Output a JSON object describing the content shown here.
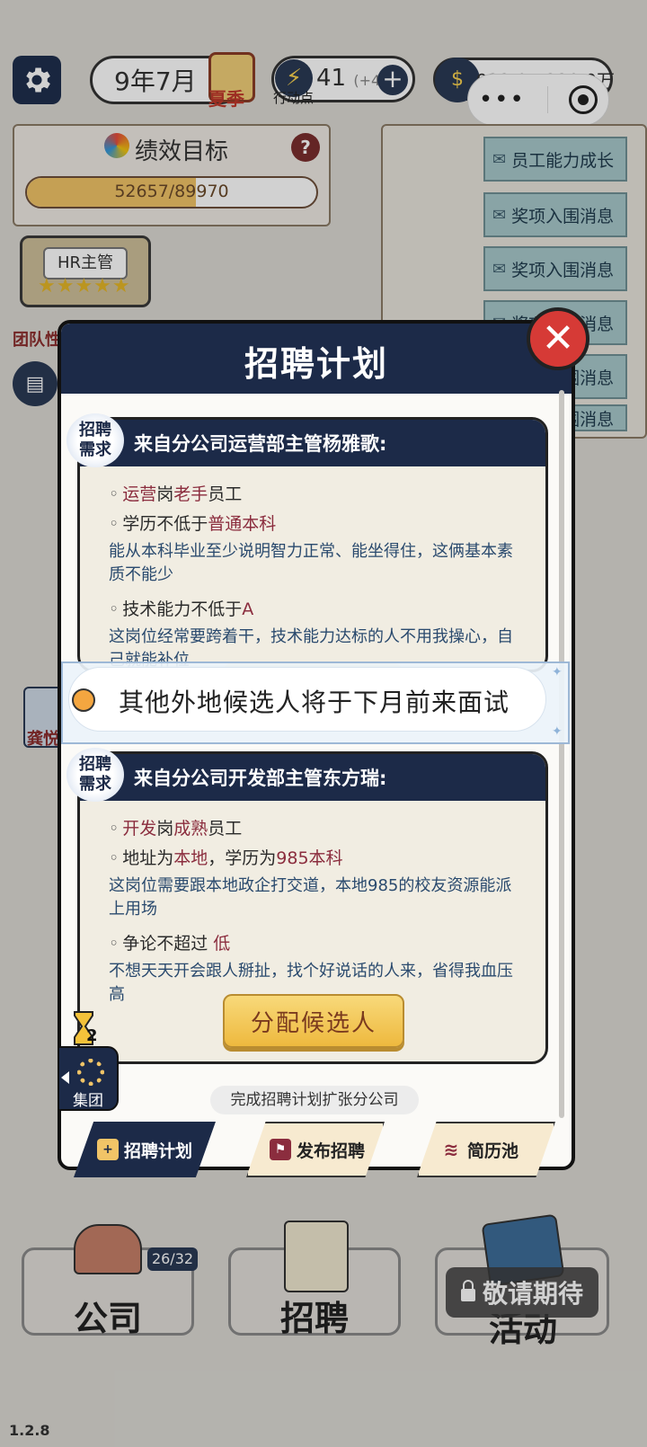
{
  "hud": {
    "date": "9年7月",
    "season": "夏季",
    "energy_value": "41",
    "energy_bonus": "(+4)",
    "energy_label": "行动点",
    "energy_plus": "+",
    "money": "933.9/1330.0万",
    "money_icon": "$"
  },
  "performance": {
    "title": "绩效目标",
    "help": "?",
    "progress_text": "52657/89970",
    "progress_fraction": 0.585
  },
  "hr": {
    "label": "HR主管",
    "stars": "★★★★★"
  },
  "team_label": "团队性",
  "messages": [
    "员工能力成长",
    "奖项入围消息",
    "奖项入围消息",
    "奖项入围消息",
    "奖项入围消息",
    "奖项入围消息"
  ],
  "side_employee_name": "龚悦",
  "modal": {
    "title": "招聘计划",
    "close_symbol": "✕",
    "badge_text_line1": "招聘",
    "badge_text_line2": "需求",
    "card1": {
      "header": "来自分公司运营部主管杨雅歌:",
      "item1_pre": "运营",
      "item1_mid": "岗",
      "item1_hl": "老手",
      "item1_post": "员工",
      "item2_pre": "学历不低于",
      "item2_hl": "普通本科",
      "item2_desc": "能从本科毕业至少说明智力正常、能坐得住，这俩基本素质不能少",
      "item3_pre": "技术能力不低于",
      "item3_hl": "A",
      "item3_desc": "这岗位经常要跨着干，技术能力达标的人不用我操心，自己就能补位"
    },
    "card2": {
      "header": "来自分公司开发部主管东方瑞:",
      "item1_pre": "开发",
      "item1_mid": "岗",
      "item1_hl": "成熟",
      "item1_post": "员工",
      "item2_a": "地址为",
      "item2_hl1": "本地",
      "item2_b": "，学历为",
      "item2_hl2": "985本科",
      "item2_desc": "这岗位需要跟本地政企打交道，本地985的校友资源能派上用场",
      "item3_pre": "争论不超过 ",
      "item3_hl": "低",
      "item3_desc": "不想天天开会跟人掰扯，找个好说话的人来，省得我血压高"
    },
    "assign_button": "分配候选人",
    "toast": "其他外地候选人将于下月前来面试",
    "timer_count": "2",
    "group_label": "集团",
    "expand_hint": "完成招聘计划扩张分公司",
    "tabs": [
      {
        "label": "招聘计划",
        "icon": "document-plus-icon"
      },
      {
        "label": "发布招聘",
        "icon": "megaphone-icon"
      },
      {
        "label": "简历池",
        "icon": "stack-icon"
      }
    ]
  },
  "bottom_nav": {
    "company": "公司",
    "company_count": "26/32",
    "recruit": "招聘",
    "event": "活动",
    "coming_soon": "敬请期待"
  },
  "version": "1.2.8",
  "colors": {
    "navy": "#1c2a48",
    "highlight": "#8b2d3e",
    "gold": "#eeb93e",
    "close_red": "#d63a36"
  }
}
